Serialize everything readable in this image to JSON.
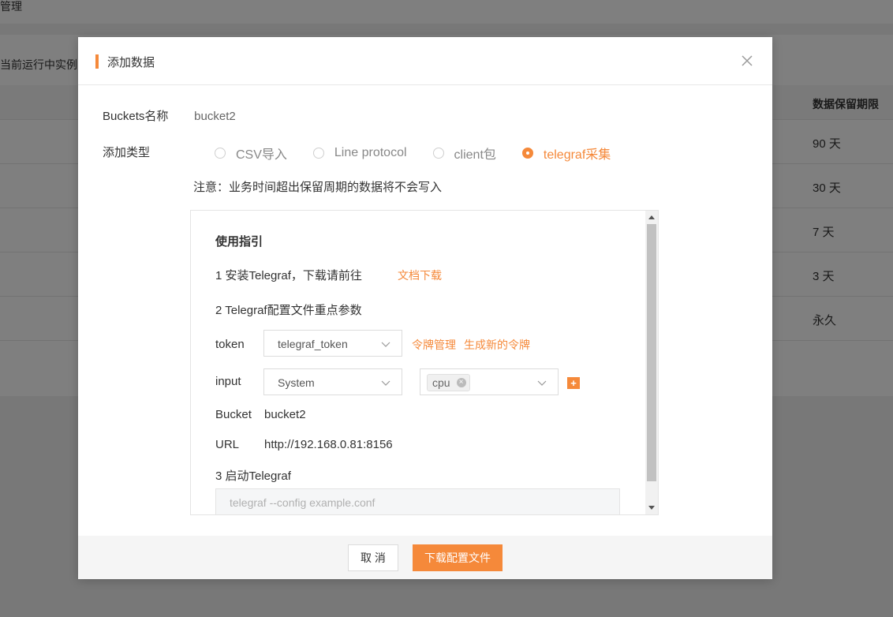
{
  "background": {
    "breadcrumb": "管理",
    "instance_label": "当前运行中实例",
    "table": {
      "header": "数据保留期限",
      "rows": [
        "90 天",
        "30 天",
        "7 天",
        "3 天",
        "永久"
      ]
    }
  },
  "modal": {
    "title": "添加数据",
    "bucket_label": "Buckets名称",
    "bucket_value": "bucket2",
    "type_label": "添加类型",
    "types": [
      {
        "label": "CSV导入",
        "checked": false
      },
      {
        "label": "Line protocol",
        "checked": false
      },
      {
        "label": "client包",
        "checked": false
      },
      {
        "label": "telegraf采集",
        "checked": true
      }
    ],
    "notice": "注意：业务时间超出保留周期的数据将不会写入",
    "guide": {
      "title": "使用指引",
      "step1": "1 安装Telegraf，下载请前往",
      "step1_link": "文档下载",
      "step2": "2 Telegraf配置文件重点参数",
      "token_label": "token",
      "token_value": "telegraf_token",
      "token_manage_link": "令牌管理",
      "token_new_link": "生成新的令牌",
      "input_label": "input",
      "input_value": "System",
      "input_tag": "cpu",
      "add_symbol": "+",
      "bucket_label": "Bucket",
      "bucket_value": "bucket2",
      "url_label": "URL",
      "url_value": "http://192.168.0.81:8156",
      "step3": "3 启动Telegraf",
      "command_placeholder": "telegraf --config example.conf"
    },
    "cancel_label": "取 消",
    "download_label": "下载配置文件"
  },
  "colors": {
    "accent": "#f5893a",
    "overlay": "rgba(0,0,0,0.5)"
  }
}
